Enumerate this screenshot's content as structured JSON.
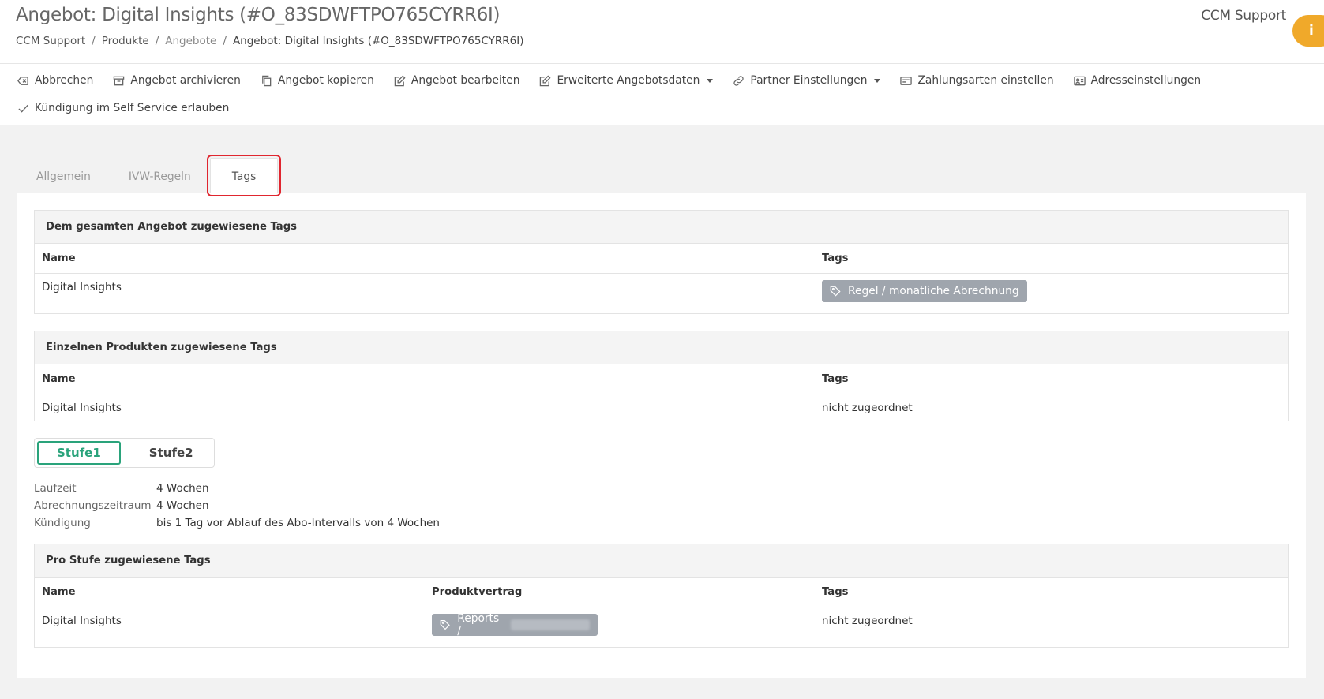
{
  "header": {
    "title": "Angebot: Digital Insights (#O_83SDWFTPO765CYRR6I)",
    "breadcrumb": [
      "CCM Support",
      "Produkte",
      "Angebote",
      "Angebot: Digital Insights (#O_83SDWFTPO765CYRR6I)"
    ],
    "user": "CCM Support",
    "info_icon": "i"
  },
  "toolbar": {
    "row1": [
      {
        "label": "Abbrechen",
        "icon": "cancel-icon"
      },
      {
        "label": "Angebot archivieren",
        "icon": "archive-icon"
      },
      {
        "label": "Angebot kopieren",
        "icon": "copy-icon"
      },
      {
        "label": "Angebot bearbeiten",
        "icon": "edit-icon"
      },
      {
        "label": "Erweiterte Angebotsdaten",
        "icon": "edit-icon",
        "dropdown": true
      },
      {
        "label": "Partner Einstellungen",
        "icon": "link-icon",
        "dropdown": true
      },
      {
        "label": "Zahlungsarten einstellen",
        "icon": "card-icon"
      },
      {
        "label": "Adresseinstellungen",
        "icon": "address-card-icon"
      }
    ],
    "row2": [
      {
        "label": "Kündigung im Self Service erlauben",
        "icon": "check-icon"
      }
    ]
  },
  "tabs": [
    "Allgemein",
    "IVW-Regeln",
    "Tags"
  ],
  "active_tab": "Tags",
  "offer_tags": {
    "heading": "Dem gesamten Angebot zugewiesene Tags",
    "col_name": "Name",
    "col_tags": "Tags",
    "row_name": "Digital Insights",
    "tag": "Regel / monatliche Abrechnung"
  },
  "product_tags": {
    "heading": "Einzelnen Produkten zugewiesene Tags",
    "col_name": "Name",
    "col_tags": "Tags",
    "row_name": "Digital Insights",
    "row_tags": "nicht zugeordnet"
  },
  "stufen": [
    "Stufe1",
    "Stufe2"
  ],
  "active_stufe": "Stufe1",
  "stufe_info": [
    {
      "label": "Laufzeit",
      "value": "4 Wochen"
    },
    {
      "label": "Abrechnungszeitraum",
      "value": "4 Wochen"
    },
    {
      "label": "Kündigung",
      "value": "bis 1 Tag vor Ablauf des Abo-Intervalls von 4 Wochen"
    }
  ],
  "stufe_tags": {
    "heading": "Pro Stufe zugewiesene Tags",
    "col_name": "Name",
    "col_contract": "Produktvertrag",
    "col_tags": "Tags",
    "row_name": "Digital Insights",
    "contract_tag": "Reports /",
    "row_tags": "nicht zugeordnet"
  },
  "colors": {
    "accent_green": "#2aa37b",
    "badge_orange": "#f0a92a",
    "highlight_red": "#e0262f",
    "tag_gray": "#9fa5ad"
  }
}
